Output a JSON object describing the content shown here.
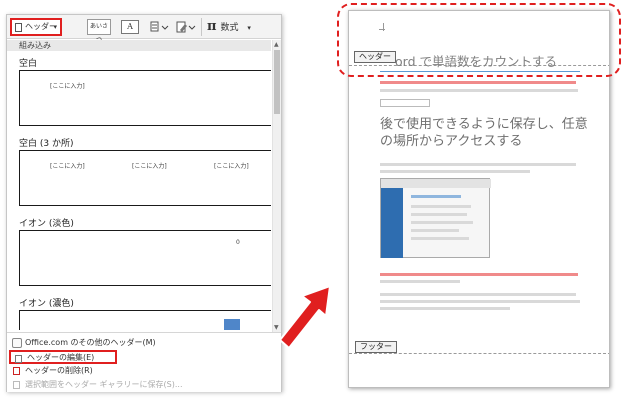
{
  "ribbon": {
    "header_label": "ヘッダー",
    "greeting_label": "あいさつ",
    "textbox_label": "A",
    "equation_label": "数式"
  },
  "gallery": {
    "builtin_label": "組み込み",
    "items": [
      {
        "name": "空白",
        "placeholders": [
          "[ここに入力]"
        ]
      },
      {
        "name": "空白 (3 か所)",
        "placeholders": [
          "[ここに入力]",
          "[ここに入力]",
          "[ここに入力]"
        ]
      },
      {
        "name": "イオン (淡色)",
        "placeholders": [
          "0"
        ]
      },
      {
        "name": "イオン (濃色)",
        "placeholders": [
          "0"
        ]
      }
    ]
  },
  "menu": {
    "more_headers": "Office.com のその他のヘッダー(M)",
    "edit_header": "ヘッダーの編集(E)",
    "delete_header": "ヘッダーの削除(R)",
    "save_selection": "選択範囲をヘッダー ギャラリーに保存(S)..."
  },
  "document": {
    "header_tag": "ヘッダー",
    "footer_tag": "フッター",
    "title": "ord で単語数をカウントする",
    "heading2": "後で使用できるように保存し、任意の場所からアクセスする"
  },
  "colors": {
    "highlight": "#e01f1f",
    "accent_blue": "#5b9bd5",
    "arrow_red": "#e01f1f"
  }
}
